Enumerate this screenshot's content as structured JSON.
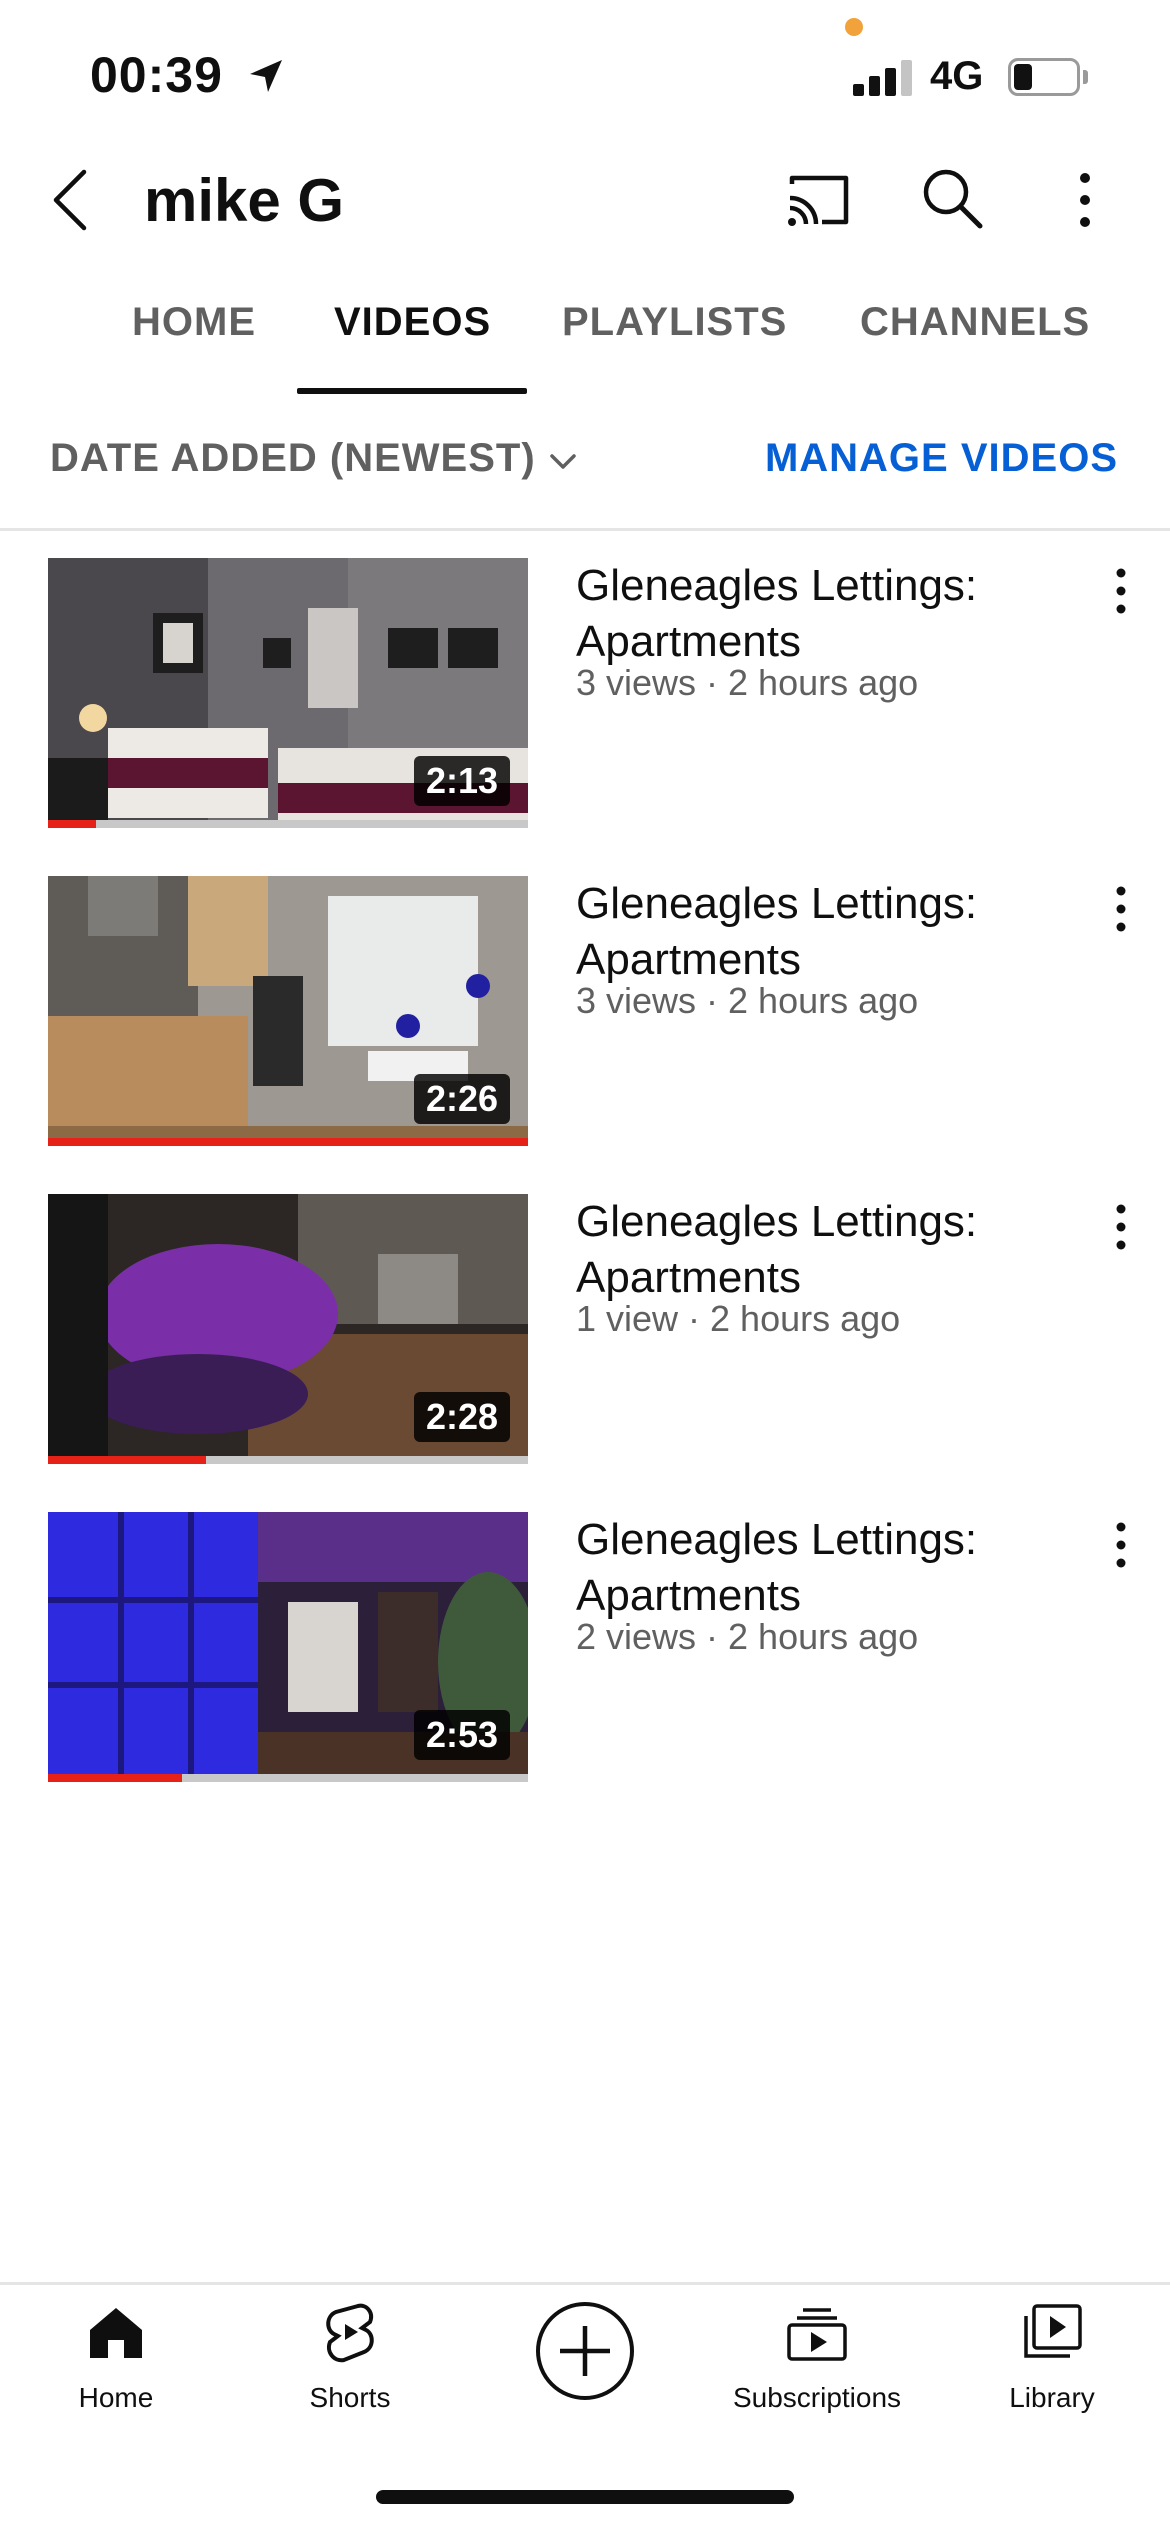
{
  "status_bar": {
    "time": "00:39",
    "network": "4G"
  },
  "header": {
    "channel_name": "mike G"
  },
  "tabs": [
    {
      "label": "HOME",
      "active": false
    },
    {
      "label": "VIDEOS",
      "active": true
    },
    {
      "label": "PLAYLISTS",
      "active": false
    },
    {
      "label": "CHANNELS",
      "active": false
    }
  ],
  "filter": {
    "sort_label": "DATE ADDED (NEWEST)",
    "manage_label": "MANAGE VIDEOS"
  },
  "videos": [
    {
      "title": "Gleneagles Lettings: Apartments",
      "meta": "3 views · 2 hours ago",
      "duration": "2:13",
      "watched_fraction": 0.1
    },
    {
      "title": "Gleneagles Lettings: Apartments",
      "meta": "3 views · 2 hours ago",
      "duration": "2:26",
      "watched_fraction": 1.0
    },
    {
      "title": "Gleneagles Lettings: Apartments",
      "meta": "1 view · 2 hours ago",
      "duration": "2:28",
      "watched_fraction": 0.33
    },
    {
      "title": "Gleneagles Lettings: Apartments",
      "meta": "2 views · 2 hours ago",
      "duration": "2:53",
      "watched_fraction": 0.28
    }
  ],
  "bottom_nav": [
    {
      "label": "Home",
      "icon": "home-icon"
    },
    {
      "label": "Shorts",
      "icon": "shorts-icon"
    },
    {
      "label": "",
      "icon": "create-icon"
    },
    {
      "label": "Subscriptions",
      "icon": "subscriptions-icon"
    },
    {
      "label": "Library",
      "icon": "library-icon"
    }
  ],
  "colors": {
    "accent_link": "#065fd4",
    "progress": "#e62117",
    "text_secondary": "#606060"
  }
}
